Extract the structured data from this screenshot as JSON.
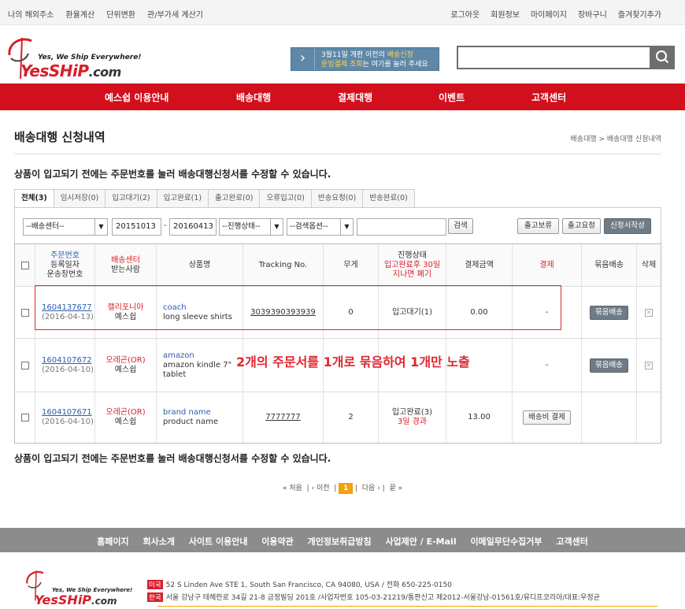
{
  "topbar": {
    "left": [
      "나의 해외주소",
      "환율계산",
      "단위변환",
      "관/부가세 계산기"
    ],
    "right": [
      "로그아웃",
      "회원정보",
      "마이페이지",
      "장바구니",
      "즐겨찾기추가"
    ]
  },
  "logo": {
    "tagline": "Yes, We Ship Everywhere!",
    "brand_main": "YesSHiP",
    "brand_suffix": ".com"
  },
  "banner": {
    "line1_a": "3월11일 개편 이전의 ",
    "line1_hl": "배송신청",
    "line2_hl": "운임결제 조회",
    "line2_b": "는 여기를 눌러 주세요"
  },
  "nav": [
    "예스쉽 이용안내",
    "배송대행",
    "결제대행",
    "이벤트",
    "고객센터"
  ],
  "page": {
    "title": "배송대행 신청내역",
    "breadcrumb": "배송대행 > 배송대행 신청내역",
    "notice": "상품이 입고되기 전에는 주문번호를 눌러 배송대행신청서를 수정할 수 있습니다."
  },
  "tabs": [
    "전체(3)",
    "임시저장(0)",
    "입고대기(2)",
    "입고완료(1)",
    "출고완료(0)",
    "오류입고(0)",
    "반송요청(0)",
    "반송완료(0)"
  ],
  "filters": {
    "center": "--배송센터--",
    "date_from": "20151013",
    "date_sep": "-",
    "date_to": "20160413",
    "status": "--진행상태--",
    "search_option": "--검색옵션--",
    "search_button": "검색",
    "hold_button": "출고보류",
    "request_button": "출고요청",
    "new_button": "신청서작성"
  },
  "table": {
    "headers": {
      "order_no": "주문번호",
      "reg_date": "등록일자",
      "tracking_sub": "운송장번호",
      "center": "배송센터",
      "recipient": "받는사람",
      "product": "상품명",
      "tracking": "Tracking No.",
      "weight": "무게",
      "status": "진행상태",
      "status_note1": "입고완료후 30일",
      "status_note2": "지나면 폐기",
      "amount": "결제금액",
      "payment": "결제",
      "bundle": "묶음배송",
      "delete": "삭제"
    },
    "rows": [
      {
        "order_no": "1604137677",
        "date": "(2016-04-13)",
        "center": "캘리포니아",
        "recipient": "예스쉽",
        "shop": "coach",
        "product": "long sleeve shirts",
        "tracking": "3039390393939",
        "weight": "0",
        "status": "입고대기(1)",
        "status_note": "",
        "amount": "0.00",
        "payment": "-",
        "bundle": "묶음배송"
      },
      {
        "order_no": "1604107672",
        "date": "(2016-04-10)",
        "center": "오레곤(OR)",
        "recipient": "예스쉽",
        "shop": "amazon",
        "product": "amazon kindle 7\" tablet",
        "tracking": "",
        "weight": "",
        "status": "",
        "status_note": "",
        "amount": "",
        "payment": "-",
        "bundle": "묶음배송"
      },
      {
        "order_no": "1604107671",
        "date": "(2016-04-10)",
        "center": "오레곤(OR)",
        "recipient": "예스쉽",
        "shop": "brand name",
        "product": "product name",
        "tracking": "7777777",
        "weight": "2",
        "status": "입고완료(3)",
        "status_note": "3일 경과",
        "amount": "13.00",
        "payment": "배송비 결제",
        "bundle": ""
      }
    ]
  },
  "annotation": "2개의 주문서를 1개로 묶음하여 1개만 노출",
  "pager": {
    "first": "처음",
    "prev": "이전",
    "current": "1",
    "next": "다음",
    "last": "끝"
  },
  "footer": {
    "links": [
      "홈페이지",
      "회사소개",
      "사이트 이용안내",
      "이용약관",
      "개인정보취급방침",
      "사업제안 / E-Mail",
      "이메일무단수집거부",
      "고객센터"
    ],
    "us_badge": "미국",
    "us_address": "52 S Linden Ave STE 1, South San Francisco, CA 94080, USA / 전화 650-225-0150",
    "kr_badge": "한국",
    "kr_address": "서울 강남구 테헤란로 34길 21-8 금정빌딩 201호 /사업자번호 105-03-21219/통판신고 제2012-서울강남-01561호/유디프코리아/대표:우정균"
  },
  "colors": {
    "accent": "#d2101d",
    "footer": "#8c8c8c",
    "highlight": "#e0262f",
    "pager": "#f2a10f"
  }
}
